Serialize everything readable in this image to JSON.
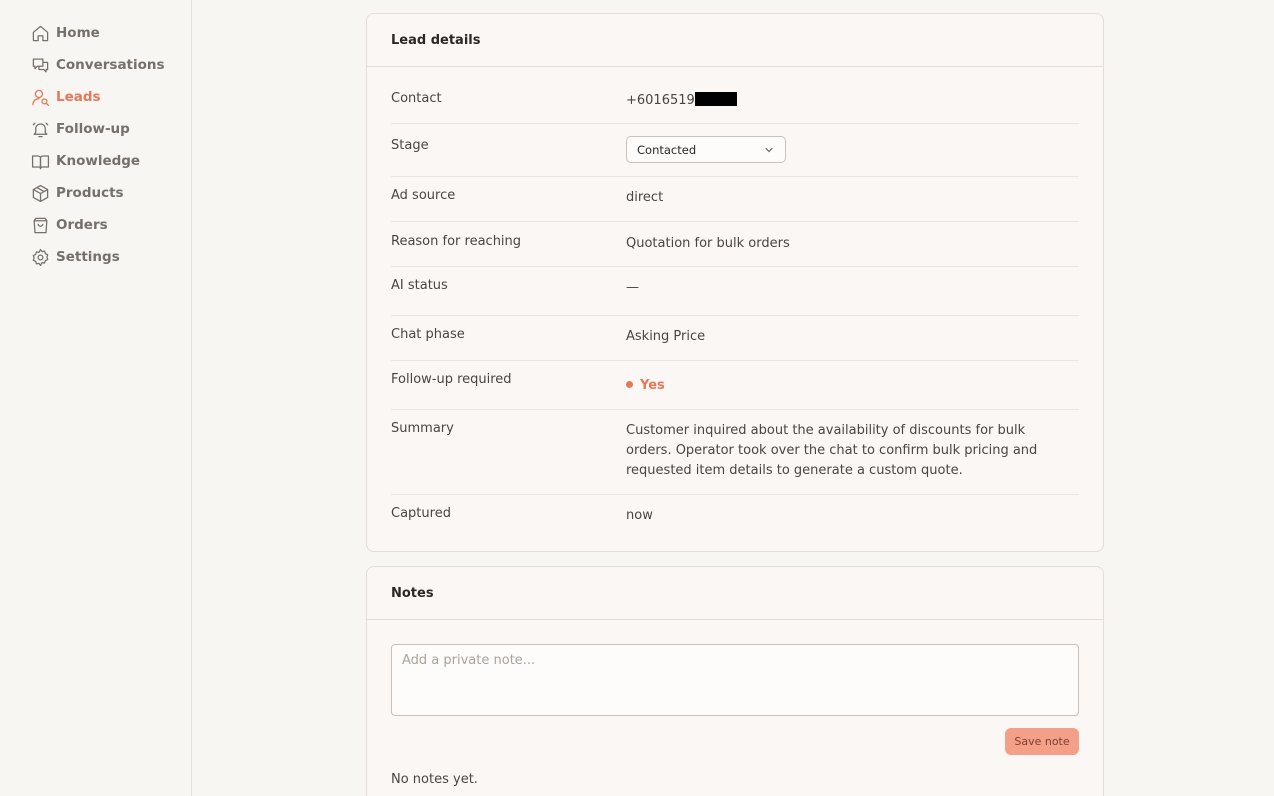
{
  "sidebar": {
    "items": [
      {
        "label": "Home",
        "icon": "home-icon",
        "active": false
      },
      {
        "label": "Conversations",
        "icon": "chat-icon",
        "active": false
      },
      {
        "label": "Leads",
        "icon": "user-search-icon",
        "active": true
      },
      {
        "label": "Follow-up",
        "icon": "bell-icon",
        "active": false
      },
      {
        "label": "Knowledge",
        "icon": "book-icon",
        "active": false
      },
      {
        "label": "Products",
        "icon": "box-icon",
        "active": false
      },
      {
        "label": "Orders",
        "icon": "bag-icon",
        "active": false
      },
      {
        "label": "Settings",
        "icon": "gear-icon",
        "active": false
      }
    ]
  },
  "lead_details": {
    "title": "Lead details",
    "contact_label": "Contact",
    "contact_value": "+6016519",
    "stage_label": "Stage",
    "stage_value": "Contacted",
    "ad_source_label": "Ad source",
    "ad_source_value": "direct",
    "reason_label": "Reason for reaching",
    "reason_value": "Quotation for bulk orders",
    "ai_status_label": "AI status",
    "ai_status_value": "—",
    "chat_phase_label": "Chat phase",
    "chat_phase_value": "Asking Price",
    "follow_up_label": "Follow-up required",
    "follow_up_value": "Yes",
    "summary_label": "Summary",
    "summary_value": "Customer inquired about the availability of discounts for bulk orders. Operator took over the chat to confirm bulk pricing and requested item details to generate a custom quote.",
    "captured_label": "Captured",
    "captured_value": "now"
  },
  "notes": {
    "title": "Notes",
    "placeholder": "Add a private note...",
    "save_label": "Save note",
    "empty_text": "No notes yet."
  },
  "colors": {
    "accent": "#e8775a",
    "save_button": "#f4a088",
    "background": "#f8f6f3"
  }
}
